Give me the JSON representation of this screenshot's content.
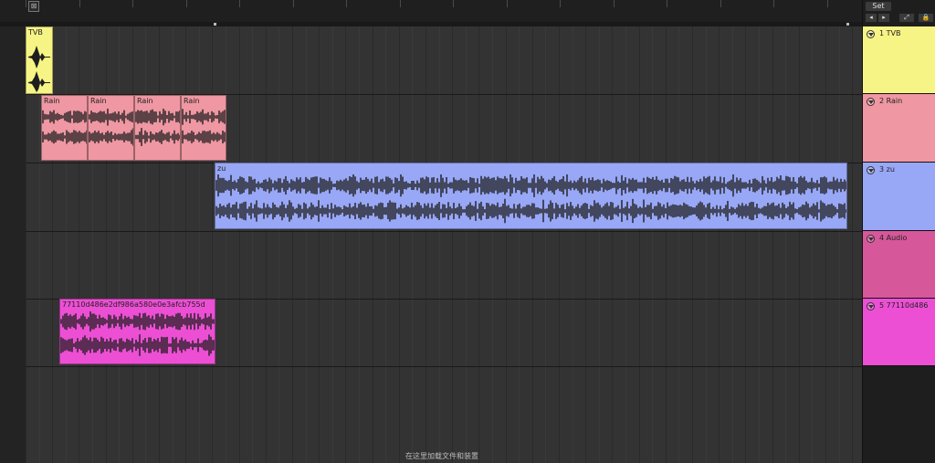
{
  "ruler": {
    "corner_glyph": "⊠"
  },
  "header": {
    "set_label": "Set",
    "back_glyph": "◂",
    "forward_glyph": "▸",
    "expand_glyph": "⤢",
    "lock_glyph": "🔒"
  },
  "tracks": [
    {
      "name": "1 TVB",
      "color": "#f7f486"
    },
    {
      "name": "2 Rain",
      "color": "#ef97a2"
    },
    {
      "name": "3 zu",
      "color": "#98a7f6"
    },
    {
      "name": "4 Audio",
      "color": "#d7579b"
    },
    {
      "name": "5 77110d486",
      "color": "#ec4fd4"
    }
  ],
  "clips": [
    {
      "title": "TVB",
      "track": "1 TVB"
    },
    {
      "title": "Rain",
      "track": "2 Rain"
    },
    {
      "title": "Rain",
      "track": "2 Rain"
    },
    {
      "title": "Rain",
      "track": "2 Rain"
    },
    {
      "title": "Rain",
      "track": "2 Rain"
    },
    {
      "title": "zu",
      "track": "3 zu"
    },
    {
      "title": "77110d486e2df986a580e0e3afcb755d",
      "track": "5 77110d486"
    }
  ],
  "status": {
    "drop_hint": "在这里加载文件和装置"
  }
}
